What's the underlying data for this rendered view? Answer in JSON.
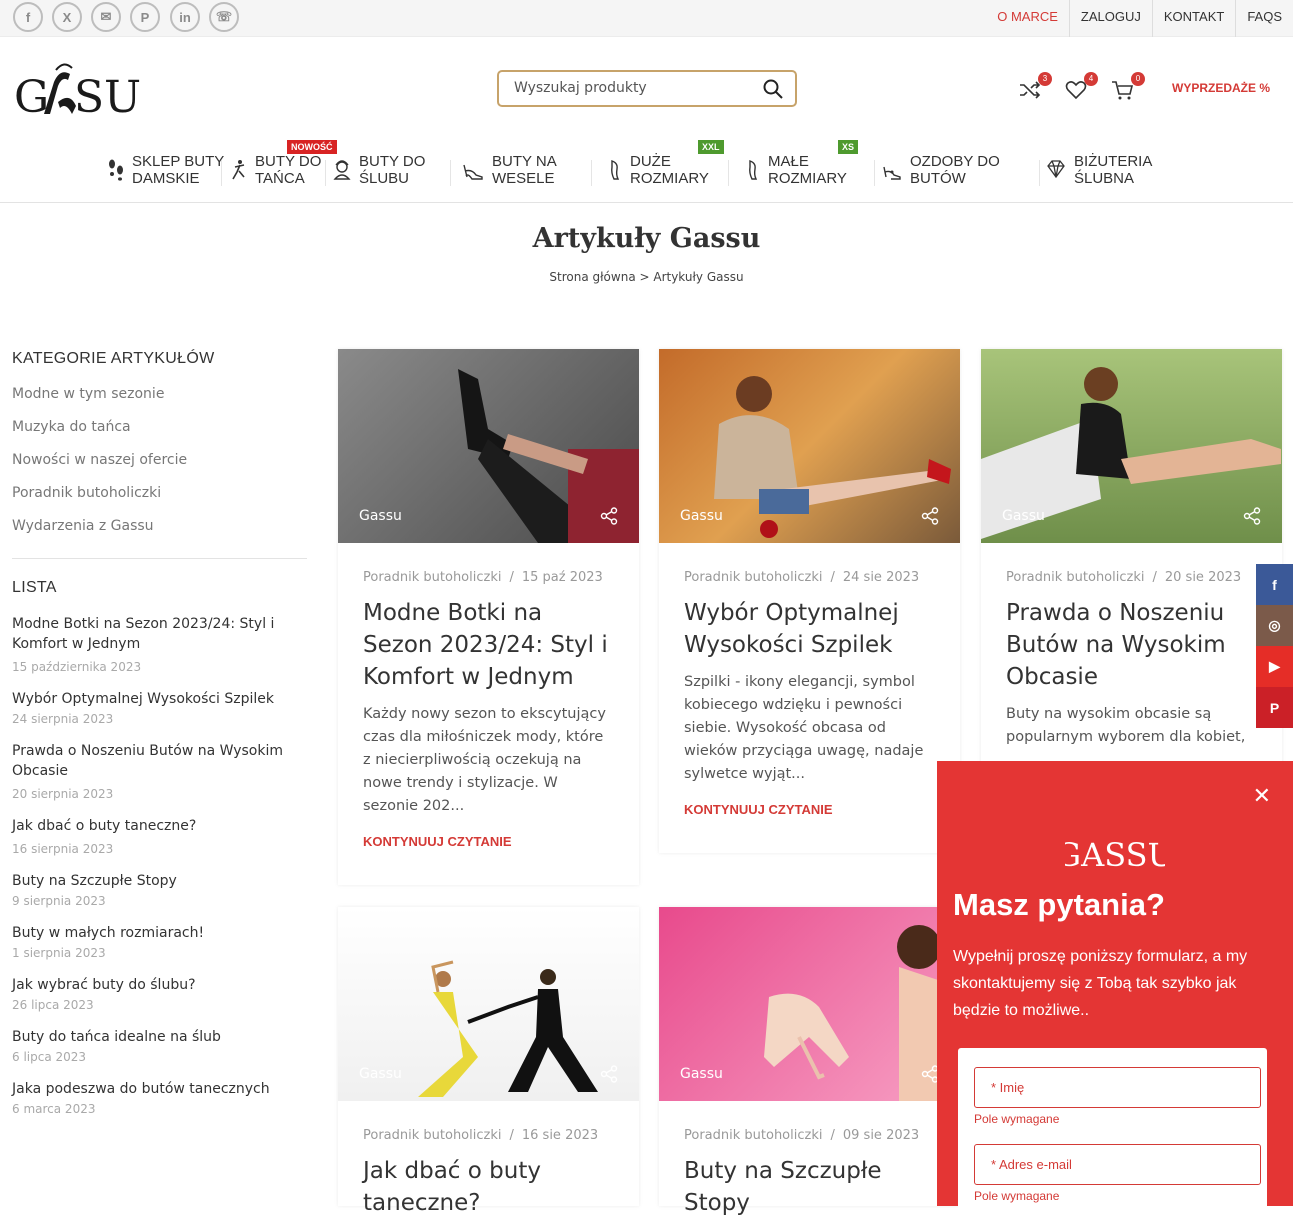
{
  "topbar": {
    "social": [
      "f",
      "X",
      "✉",
      "P",
      "in",
      "☏"
    ],
    "links": [
      "O MARCE",
      "ZALOGUJ",
      "KONTAKT",
      "FAQS"
    ]
  },
  "header": {
    "logo_text": "GASSU",
    "search_placeholder": "Wyszukaj produkty",
    "compare_count": "3",
    "wishlist_count": "4",
    "cart_count": "0",
    "sale_label": "WYPRZEDAŻE %"
  },
  "nav": {
    "items": [
      {
        "line1": "SKLEP BUTY",
        "line2": "DAMSKIE"
      },
      {
        "line1": "BUTY DO",
        "line2": "TAŃCA",
        "badge": "NOWOŚĆ"
      },
      {
        "line1": "BUTY DO",
        "line2": "ŚLUBU"
      },
      {
        "line1": "BUTY NA",
        "line2": "WESELE"
      },
      {
        "line1": "DUŻE",
        "line2": "ROZMIARY",
        "badge": "XXL"
      },
      {
        "line1": "MAŁE",
        "line2": "ROZMIARY",
        "badge": "XS"
      },
      {
        "line1": "OZDOBY DO",
        "line2": "BUTÓW"
      },
      {
        "line1": "BIŻUTERIA",
        "line2": "ŚLUBNA"
      }
    ]
  },
  "page": {
    "title": "Artykuły Gassu",
    "breadcrumb": "Strona główna > Artykuły Gassu"
  },
  "sidebar": {
    "categories_title": "KATEGORIE ARTYKUŁÓW",
    "categories": [
      "Modne w tym sezonie",
      "Muzyka do tańca",
      "Nowości w naszej ofercie",
      "Poradnik butoholiczki",
      "Wydarzenia z Gassu"
    ],
    "list_title": "LISTA",
    "articles": [
      {
        "title": "Modne Botki na Sezon 2023/24: Styl i Komfort w Jednym",
        "date": "15 października 2023"
      },
      {
        "title": "Wybór Optymalnej Wysokości Szpilek",
        "date": "24 sierpnia 2023"
      },
      {
        "title": "Prawda o Noszeniu Butów na Wysokim Obcasie",
        "date": "20 sierpnia 2023"
      },
      {
        "title": "Jak dbać o buty taneczne?",
        "date": "16 sierpnia 2023"
      },
      {
        "title": "Buty na Szczupłe Stopy",
        "date": "9 sierpnia 2023"
      },
      {
        "title": "Buty w małych rozmiarach!",
        "date": "1 sierpnia 2023"
      },
      {
        "title": "Jak wybrać buty do ślubu?",
        "date": "26 lipca 2023"
      },
      {
        "title": "Buty do tańca idealne na ślub",
        "date": "6 lipca 2023"
      },
      {
        "title": "Jaka podeszwa do butów tanecznych",
        "date": "6 marca 2023"
      }
    ]
  },
  "posts": [
    {
      "label": "Gassu",
      "category": "Poradnik butoholiczki",
      "date": "15 paź 2023",
      "title": "Modne Botki na Sezon 2023/24: Styl i Komfort w Jednym",
      "excerpt": "Każdy nowy sezon to ekscytujący czas dla miłośniczek mody, które z niecierpliwością oczekują na nowe trendy i stylizacje. W sezonie 202...",
      "more": "KONTYNUUJ CZYTANIE"
    },
    {
      "label": "Gassu",
      "category": "Poradnik butoholiczki",
      "date": "24 sie 2023",
      "title": "Wybór Optymalnej Wysokości Szpilek",
      "excerpt": "Szpilki - ikony elegancji, symbol kobiecego wdzięku i pewności siebie. Wysokość obcasa od wieków przyciąga uwagę, nadaje sylwetce wyjąt...",
      "more": "KONTYNUUJ CZYTANIE"
    },
    {
      "label": "Gassu",
      "category": "Poradnik butoholiczki",
      "date": "20 sie 2023",
      "title": "Prawda o Noszeniu Butów na Wysokim Obcasie",
      "excerpt": "Buty na wysokim obcasie są popularnym wyborem dla kobiet,"
    },
    {
      "label": "Gassu",
      "category": "Poradnik butoholiczki",
      "date": "16 sie 2023",
      "title": "Jak dbać o buty taneczne?"
    },
    {
      "label": "Gassu",
      "category": "Poradnik butoholiczki",
      "date": "09 sie 2023",
      "title": "Buty na Szczupłe Stopy"
    }
  ],
  "side_social": [
    "f",
    "◎",
    "▶",
    "P"
  ],
  "popup": {
    "close": "✕",
    "logo": "GASSU",
    "title": "Masz pytania?",
    "text": "Wypełnij proszę poniższy formularz, a my skontaktujemy się z Tobą tak szybko jak będzie to możliwe..",
    "field_name": "* Imię",
    "field_email": "* Adres e-mail",
    "required": "Pole wymagane"
  },
  "colors": {
    "accent": "#d43a36",
    "gold": "#c7a36a",
    "badge_new": "#d82323",
    "badge_size": "#4e9a2e"
  }
}
